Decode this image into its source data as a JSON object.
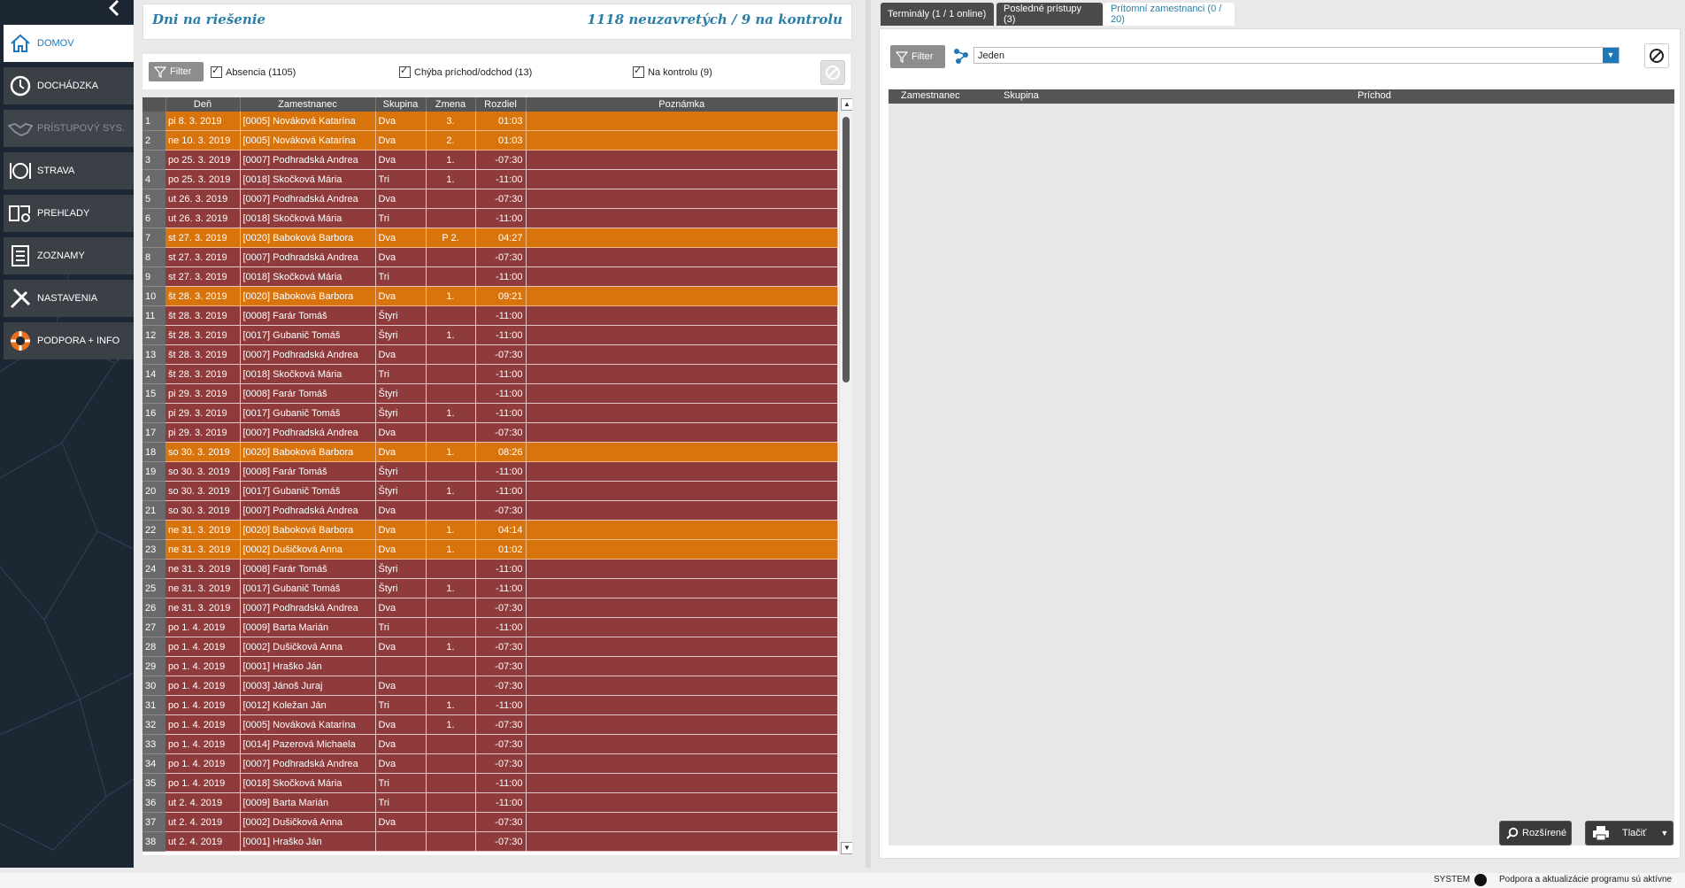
{
  "sidebar": {
    "items": [
      {
        "label": "DOMOV",
        "icon": "home-icon",
        "state": "active"
      },
      {
        "label": "DOCHÁDZKA",
        "icon": "clock-icon",
        "state": "normal"
      },
      {
        "label": "PRÍSTUPOVÝ SYS.",
        "icon": "handshake-icon",
        "state": "disabled"
      },
      {
        "label": "STRAVA",
        "icon": "plate-icon",
        "state": "normal"
      },
      {
        "label": "PREHĽADY",
        "icon": "book-search-icon",
        "state": "normal"
      },
      {
        "label": "ZOZNAMY",
        "icon": "list-icon",
        "state": "normal"
      },
      {
        "label": "NASTAVENIA",
        "icon": "tools-icon",
        "state": "normal"
      },
      {
        "label": "PODPORA + INFO",
        "icon": "lifebuoy-icon",
        "state": "normal"
      }
    ]
  },
  "header": {
    "title": "Dni na riešenie",
    "summary": "1118 neuzavretých / 9 na kontrolu"
  },
  "filterbar": {
    "filter_label": "Filter",
    "checks": [
      {
        "label": "Absencia (1105)",
        "checked": true
      },
      {
        "label": "Chýba príchod/odchod (13)",
        "checked": true
      },
      {
        "label": "Na kontrolu (9)",
        "checked": true
      }
    ]
  },
  "grid": {
    "columns": [
      "",
      "Deň",
      "Zamestnanec",
      "Skupina",
      "Zmena",
      "Rozdiel",
      "Poznámka"
    ],
    "rows": [
      {
        "n": "1",
        "day": "pi 8. 3. 2019",
        "emp": "[0005] Nováková Katarína",
        "grp": "Dva",
        "shift": "3.",
        "diff": "01:03",
        "note": "",
        "color": "orange"
      },
      {
        "n": "2",
        "day": "ne 10. 3. 2019",
        "emp": "[0005] Nováková Katarína",
        "grp": "Dva",
        "shift": "2.",
        "diff": "01:03",
        "note": "",
        "color": "orange"
      },
      {
        "n": "3",
        "day": "po 25. 3. 2019",
        "emp": "[0007] Podhradská Andrea",
        "grp": "Dva",
        "shift": "1.",
        "diff": "-07:30",
        "note": "",
        "color": "red"
      },
      {
        "n": "4",
        "day": "po 25. 3. 2019",
        "emp": "[0018] Skočková Mária",
        "grp": "Tri",
        "shift": "1.",
        "diff": "-11:00",
        "note": "",
        "color": "red"
      },
      {
        "n": "5",
        "day": "ut 26. 3. 2019",
        "emp": "[0007] Podhradská Andrea",
        "grp": "Dva",
        "shift": "",
        "diff": "-07:30",
        "note": "",
        "color": "red"
      },
      {
        "n": "6",
        "day": "ut 26. 3. 2019",
        "emp": "[0018] Skočková Mária",
        "grp": "Tri",
        "shift": "",
        "diff": "-11:00",
        "note": "",
        "color": "red"
      },
      {
        "n": "7",
        "day": "st 27. 3. 2019",
        "emp": "[0020] Baboková Barbora",
        "grp": "Dva",
        "shift": "P 2.",
        "diff": "04:27",
        "note": "",
        "color": "orange"
      },
      {
        "n": "8",
        "day": "st 27. 3. 2019",
        "emp": "[0007] Podhradská Andrea",
        "grp": "Dva",
        "shift": "",
        "diff": "-07:30",
        "note": "",
        "color": "red"
      },
      {
        "n": "9",
        "day": "st 27. 3. 2019",
        "emp": "[0018] Skočková Mária",
        "grp": "Tri",
        "shift": "",
        "diff": "-11:00",
        "note": "",
        "color": "red"
      },
      {
        "n": "10",
        "day": "št 28. 3. 2019",
        "emp": "[0020] Baboková Barbora",
        "grp": "Dva",
        "shift": "1.",
        "diff": "09:21",
        "note": "",
        "color": "orange"
      },
      {
        "n": "11",
        "day": "št 28. 3. 2019",
        "emp": "[0008] Farár Tomáš",
        "grp": "Štyri",
        "shift": "",
        "diff": "-11:00",
        "note": "",
        "color": "red"
      },
      {
        "n": "12",
        "day": "št 28. 3. 2019",
        "emp": "[0017] Gubanič Tomáš",
        "grp": "Štyri",
        "shift": "1.",
        "diff": "-11:00",
        "note": "",
        "color": "red"
      },
      {
        "n": "13",
        "day": "št 28. 3. 2019",
        "emp": "[0007] Podhradská Andrea",
        "grp": "Dva",
        "shift": "",
        "diff": "-07:30",
        "note": "",
        "color": "red"
      },
      {
        "n": "14",
        "day": "št 28. 3. 2019",
        "emp": "[0018] Skočková Mária",
        "grp": "Tri",
        "shift": "",
        "diff": "-11:00",
        "note": "",
        "color": "red"
      },
      {
        "n": "15",
        "day": "pi 29. 3. 2019",
        "emp": "[0008] Farár Tomáš",
        "grp": "Štyri",
        "shift": "",
        "diff": "-11:00",
        "note": "",
        "color": "red"
      },
      {
        "n": "16",
        "day": "pi 29. 3. 2019",
        "emp": "[0017] Gubanič Tomáš",
        "grp": "Štyri",
        "shift": "1.",
        "diff": "-11:00",
        "note": "",
        "color": "red"
      },
      {
        "n": "17",
        "day": "pi 29. 3. 2019",
        "emp": "[0007] Podhradská Andrea",
        "grp": "Dva",
        "shift": "",
        "diff": "-07:30",
        "note": "",
        "color": "red"
      },
      {
        "n": "18",
        "day": "so 30. 3. 2019",
        "emp": "[0020] Baboková Barbora",
        "grp": "Dva",
        "shift": "1.",
        "diff": "08:26",
        "note": "",
        "color": "orange"
      },
      {
        "n": "19",
        "day": "so 30. 3. 2019",
        "emp": "[0008] Farár Tomáš",
        "grp": "Štyri",
        "shift": "",
        "diff": "-11:00",
        "note": "",
        "color": "red"
      },
      {
        "n": "20",
        "day": "so 30. 3. 2019",
        "emp": "[0017] Gubanič Tomáš",
        "grp": "Štyri",
        "shift": "1.",
        "diff": "-11:00",
        "note": "",
        "color": "red"
      },
      {
        "n": "21",
        "day": "so 30. 3. 2019",
        "emp": "[0007] Podhradská Andrea",
        "grp": "Dva",
        "shift": "",
        "diff": "-07:30",
        "note": "",
        "color": "red"
      },
      {
        "n": "22",
        "day": "ne 31. 3. 2019",
        "emp": "[0020] Baboková Barbora",
        "grp": "Dva",
        "shift": "1.",
        "diff": "04:14",
        "note": "",
        "color": "orange"
      },
      {
        "n": "23",
        "day": "ne 31. 3. 2019",
        "emp": "[0002] Dušičková Anna",
        "grp": "Dva",
        "shift": "1.",
        "diff": "01:02",
        "note": "",
        "color": "orange"
      },
      {
        "n": "24",
        "day": "ne 31. 3. 2019",
        "emp": "[0008] Farár Tomáš",
        "grp": "Štyri",
        "shift": "",
        "diff": "-11:00",
        "note": "",
        "color": "red"
      },
      {
        "n": "25",
        "day": "ne 31. 3. 2019",
        "emp": "[0017] Gubanič Tomáš",
        "grp": "Štyri",
        "shift": "1.",
        "diff": "-11:00",
        "note": "",
        "color": "red"
      },
      {
        "n": "26",
        "day": "ne 31. 3. 2019",
        "emp": "[0007] Podhradská Andrea",
        "grp": "Dva",
        "shift": "",
        "diff": "-07:30",
        "note": "",
        "color": "red"
      },
      {
        "n": "27",
        "day": "po 1. 4. 2019",
        "emp": "[0009] Barta Marián",
        "grp": "Tri",
        "shift": "",
        "diff": "-11:00",
        "note": "",
        "color": "red"
      },
      {
        "n": "28",
        "day": "po 1. 4. 2019",
        "emp": "[0002] Dušičková Anna",
        "grp": "Dva",
        "shift": "1.",
        "diff": "-07:30",
        "note": "",
        "color": "red"
      },
      {
        "n": "29",
        "day": "po 1. 4. 2019",
        "emp": "[0001] Hraško Ján",
        "grp": "",
        "shift": "",
        "diff": "-07:30",
        "note": "",
        "color": "red"
      },
      {
        "n": "30",
        "day": "po 1. 4. 2019",
        "emp": "[0003] Jánoš Juraj",
        "grp": "Dva",
        "shift": "",
        "diff": "-07:30",
        "note": "",
        "color": "red"
      },
      {
        "n": "31",
        "day": "po 1. 4. 2019",
        "emp": "[0012] Koležan Ján",
        "grp": "Tri",
        "shift": "1.",
        "diff": "-11:00",
        "note": "",
        "color": "red"
      },
      {
        "n": "32",
        "day": "po 1. 4. 2019",
        "emp": "[0005] Nováková Katarína",
        "grp": "Dva",
        "shift": "1.",
        "diff": "-07:30",
        "note": "",
        "color": "red"
      },
      {
        "n": "33",
        "day": "po 1. 4. 2019",
        "emp": "[0014] Pazerová Michaela",
        "grp": "Dva",
        "shift": "",
        "diff": "-07:30",
        "note": "",
        "color": "red"
      },
      {
        "n": "34",
        "day": "po 1. 4. 2019",
        "emp": "[0007] Podhradská Andrea",
        "grp": "Dva",
        "shift": "",
        "diff": "-07:30",
        "note": "",
        "color": "red"
      },
      {
        "n": "35",
        "day": "po 1. 4. 2019",
        "emp": "[0018] Skočková Mária",
        "grp": "Tri",
        "shift": "",
        "diff": "-11:00",
        "note": "",
        "color": "red"
      },
      {
        "n": "36",
        "day": "ut 2. 4. 2019",
        "emp": "[0009] Barta Marián",
        "grp": "Tri",
        "shift": "",
        "diff": "-11:00",
        "note": "",
        "color": "red"
      },
      {
        "n": "37",
        "day": "ut 2. 4. 2019",
        "emp": "[0002] Dušičková Anna",
        "grp": "Dva",
        "shift": "",
        "diff": "-07:30",
        "note": "",
        "color": "red"
      },
      {
        "n": "38",
        "day": "ut 2. 4. 2019",
        "emp": "[0001] Hraško Ján",
        "grp": "",
        "shift": "",
        "diff": "-07:30",
        "note": "",
        "color": "red"
      }
    ]
  },
  "right": {
    "tabs": [
      {
        "label": "Terminály (1 / 1 online)",
        "state": "dark"
      },
      {
        "label": "Posledné prístupy (3)",
        "state": "dark"
      },
      {
        "label": "Prítomní zamestnanci (0 / 20)",
        "state": "selected"
      }
    ],
    "filter_label": "Filter",
    "group_select": "Jeden",
    "columns": [
      "Zamestnanec",
      "Skupina",
      "Príchod"
    ],
    "advanced_label": "Rozšírené",
    "print_label": "Tlačiť"
  },
  "status": {
    "user": "SYSTEM",
    "message": "Podpora a aktualizácie programu sú aktívne"
  },
  "colors": {
    "accent": "#1e78b8",
    "row_red": "#8f3b3b",
    "row_orange": "#d9740d",
    "sidebar": "#1d2633"
  }
}
